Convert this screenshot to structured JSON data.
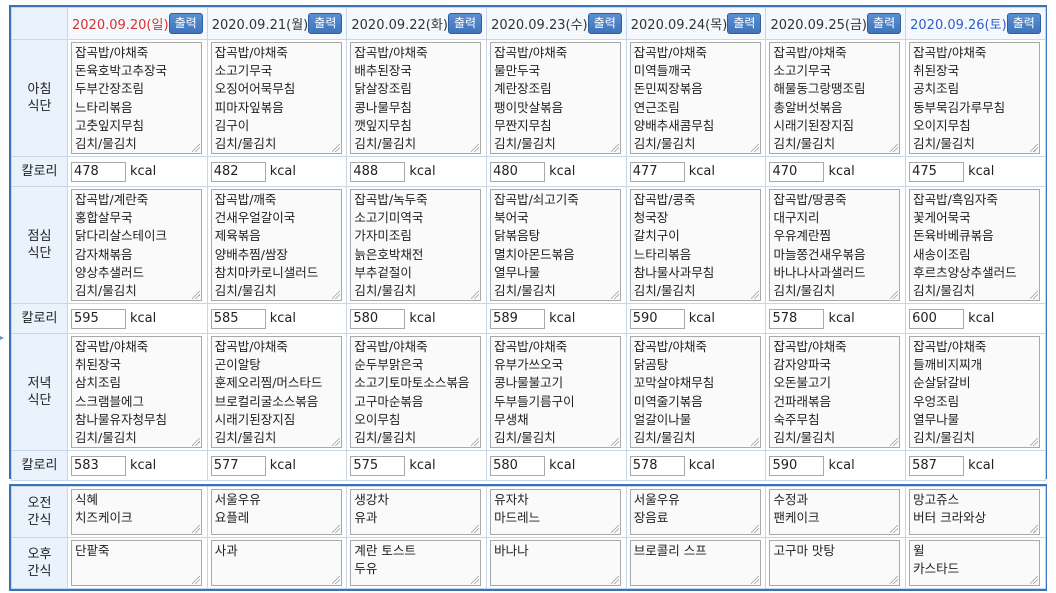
{
  "print_label": "출력",
  "days": [
    {
      "date": "2020.09.20(일)",
      "color": "sun"
    },
    {
      "date": "2020.09.21(월)",
      "color": "normal"
    },
    {
      "date": "2020.09.22(화)",
      "color": "normal"
    },
    {
      "date": "2020.09.23(수)",
      "color": "normal"
    },
    {
      "date": "2020.09.24(목)",
      "color": "normal"
    },
    {
      "date": "2020.09.25(금)",
      "color": "normal"
    },
    {
      "date": "2020.09.26(토)",
      "color": "sat"
    }
  ],
  "colors": {
    "sunday": "#d93030",
    "saturday": "#2e5ec9",
    "accent": "#3a72b7"
  },
  "labels": {
    "breakfast": [
      "아침",
      "식단"
    ],
    "lunch": [
      "점심",
      "식단"
    ],
    "dinner": [
      "저녁",
      "식단"
    ],
    "calorie": "칼로리",
    "am_snack": [
      "오전",
      "간식"
    ],
    "pm_snack": [
      "오후",
      "간식"
    ],
    "kcal_unit": "kcal"
  },
  "breakfast": [
    [
      "잡곡밥/야채죽",
      "돈육호박고추장국",
      "두부간장조림",
      "느타리볶음",
      "고춧잎지무침",
      "김치/물김치"
    ],
    [
      "잡곡밥/야채죽",
      "소고기무국",
      "오징어어묵무침",
      "피마자잎볶음",
      "김구이",
      "김치/물김치"
    ],
    [
      "잡곡밥/야채죽",
      "배추된장국",
      "닭살장조림",
      "콩나물무침",
      "깻잎지무침",
      "김치/물김치"
    ],
    [
      "잡곡밥/야채죽",
      "물만두국",
      "계란장조림",
      "팽이맛살볶음",
      "무짠지무침",
      "김치/물김치"
    ],
    [
      "잡곡밥/야채죽",
      "미역들깨국",
      "돈민찌장볶음",
      "연근조림",
      "양배추새콤무침",
      "김치/물김치"
    ],
    [
      "잡곡밥/야채죽",
      "소고기무국",
      "해물동그랑땡조림",
      "총알버섯볶음",
      "시래기된장지짐",
      "김치/물김치"
    ],
    [
      "잡곡밥/야채죽",
      "취된장국",
      "공치조림",
      "동부묵김가루무침",
      "오이지무침",
      "김치/물김치"
    ]
  ],
  "breakfast_kcal": [
    "478",
    "482",
    "488",
    "480",
    "477",
    "470",
    "475"
  ],
  "lunch": [
    [
      "잡곡밥/계란죽",
      "홍합살무국",
      "닭다리살스테이크",
      "감자채볶음",
      "양상추샐러드",
      "김치/물김치"
    ],
    [
      "잡곡밥/깨죽",
      "건새우얼갈이국",
      "제육볶음",
      "양배추찜/쌈장",
      "참치마카로니샐러드",
      "김치/물김치"
    ],
    [
      "잡곡밥/녹두죽",
      "소고기미역국",
      "가자미조림",
      "늙은호박채전",
      "부추겉절이",
      "김치/물김치"
    ],
    [
      "잡곡밥/쇠고기죽",
      "북어국",
      "닭볶음탕",
      "멸치아몬드볶음",
      "열무나물",
      "김치/물김치"
    ],
    [
      "잡곡밥/콩죽",
      "청국장",
      "갈치구이",
      "느타리볶음",
      "참나물사과무침",
      "김치/물김치"
    ],
    [
      "잡곡밥/땅콩죽",
      "대구지리",
      "우유계란찜",
      "마늘쫑건새우볶음",
      "바나나사과샐러드",
      "김치/물김치"
    ],
    [
      "잡곡밥/흑임자죽",
      "꽃게어묵국",
      "돈육바베큐볶음",
      "새송이조림",
      "후르츠양상추샐러드",
      "김치/물김치"
    ]
  ],
  "lunch_kcal": [
    "595",
    "585",
    "580",
    "589",
    "590",
    "578",
    "600"
  ],
  "dinner": [
    [
      "잡곡밥/야채죽",
      "취된장국",
      "삼치조림",
      "스크램블에그",
      "참나물유자청무침",
      "김치/물김치"
    ],
    [
      "잡곡밥/야채죽",
      "곤이알탕",
      "훈제오리찜/머스타드",
      "브로컬리굴소스볶음",
      "시래기된장지짐",
      "김치/물김치"
    ],
    [
      "잡곡밥/야채죽",
      "순두부맑은국",
      "소고기토마토소스볶음",
      "고구마순볶음",
      "오이무침",
      "김치/물김치"
    ],
    [
      "잡곡밥/야채죽",
      "유부가쓰오국",
      "콩나물불고기",
      "두부들기름구이",
      "무생채",
      "김치/물김치"
    ],
    [
      "잡곡밥/야채죽",
      "닭곰탕",
      "꼬막살야채무침",
      "미역줄기볶음",
      "얼갈이나물",
      "김치/물김치"
    ],
    [
      "잡곡밥/야채죽",
      "감자양파국",
      "오돈불고기",
      "건파래볶음",
      "숙주무침",
      "김치/물김치"
    ],
    [
      "잡곡밥/야채죽",
      "들깨비지찌개",
      "순살닭갈비",
      "우엉조림",
      "열무나물",
      "김치/물김치"
    ]
  ],
  "dinner_kcal": [
    "583",
    "577",
    "575",
    "580",
    "578",
    "590",
    "587"
  ],
  "am_snack": [
    [
      "식혜",
      "치즈케이크"
    ],
    [
      "서울우유",
      "요플레"
    ],
    [
      "생강차",
      "유과"
    ],
    [
      "유자차",
      "마드레느"
    ],
    [
      "서울우유",
      "장음료"
    ],
    [
      "수정과",
      "팬케이크"
    ],
    [
      "망고쥬스",
      "버터 크라와상"
    ]
  ],
  "pm_snack": [
    [
      "단팥죽"
    ],
    [
      "사과"
    ],
    [
      "계란 토스트",
      "두유"
    ],
    [
      "바나나"
    ],
    [
      "브로콜리 스프"
    ],
    [
      "고구마 맛탕"
    ],
    [
      "윌",
      "카스타드"
    ]
  ]
}
